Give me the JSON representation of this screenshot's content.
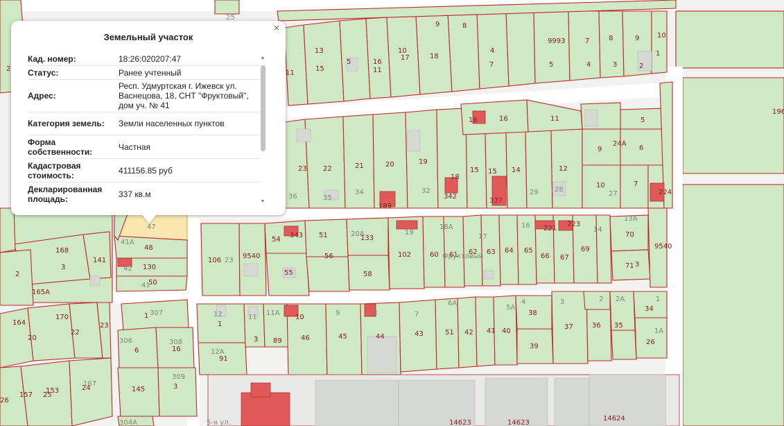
{
  "popup": {
    "title": "Земельный участок",
    "close_glyph": "×",
    "rows": [
      {
        "key": "Кад. номер:",
        "value": "18:26:020207:47"
      },
      {
        "key": "Статус:",
        "value": "Ранее учтенный"
      },
      {
        "key": "Адрес:",
        "value": "Респ. Удмуртская г. Ижевск ул. Васнецова, 18, СНТ \"Фруктовый\", дом уч. № 41"
      },
      {
        "key": "Категория земель:",
        "value": "Земли населенных пунктов"
      },
      {
        "key": "Форма собственности:",
        "value": "Частная"
      },
      {
        "key": "Кадастровая стоимость:",
        "value": "411156.85 руб"
      },
      {
        "key": "Декларированная площадь:",
        "value": "337 кв.м"
      }
    ],
    "scroll_up_glyph": "▲",
    "scroll_down_glyph": "▼"
  },
  "map": {
    "selected_parcel": "47",
    "street_labels": [
      "Фруктовый",
      "5-я ул."
    ],
    "parcel_labels": [
      "25",
      "13",
      "15",
      "5",
      "2",
      "16",
      "11",
      "10",
      "17",
      "18",
      "9",
      "8",
      "4",
      "7",
      "9993",
      "3",
      "5",
      "7",
      "8",
      "3",
      "9",
      "2",
      "10",
      "1",
      "196",
      "16",
      "16",
      "11",
      "5",
      "4",
      "23",
      "22",
      "21",
      "20",
      "19",
      "18",
      "15",
      "15",
      "14",
      "12",
      "9",
      "24А",
      "6",
      "36",
      "35",
      "34",
      "189",
      "32",
      "342",
      "337",
      "29",
      "28",
      "10",
      "27",
      "7",
      "224",
      "54",
      "343",
      "51",
      "20А",
      "133",
      "19",
      "18А",
      "17",
      "16",
      "221",
      "223",
      "14",
      "13А",
      "70",
      "71",
      "3",
      "9540",
      "106",
      "23",
      "9540",
      "56",
      "55",
      "58",
      "102",
      "60",
      "61",
      "62",
      "63",
      "64",
      "65",
      "66",
      "67",
      "69",
      "168",
      "3",
      "141",
      "2",
      "165А",
      "41А",
      "48",
      "42",
      "130",
      "41",
      "50",
      "47",
      "307",
      "1",
      "12",
      "11",
      "11А",
      "10",
      "9",
      "8",
      "7",
      "6А",
      "5А",
      "4",
      "3",
      "2",
      "2А",
      "1",
      "34",
      "38",
      "37",
      "36",
      "35",
      "1А",
      "26",
      "39",
      "40",
      "41",
      "42",
      "51",
      "43",
      "44",
      "45",
      "46",
      "89",
      "3",
      "1",
      "164",
      "170",
      "20",
      "22",
      "23",
      "306",
      "308",
      "6",
      "16",
      "12А",
      "91",
      "309",
      "3",
      "145",
      "167",
      "153",
      "157",
      "25",
      "24",
      "26",
      "304А",
      "14623",
      "14623",
      "14624"
    ]
  }
}
